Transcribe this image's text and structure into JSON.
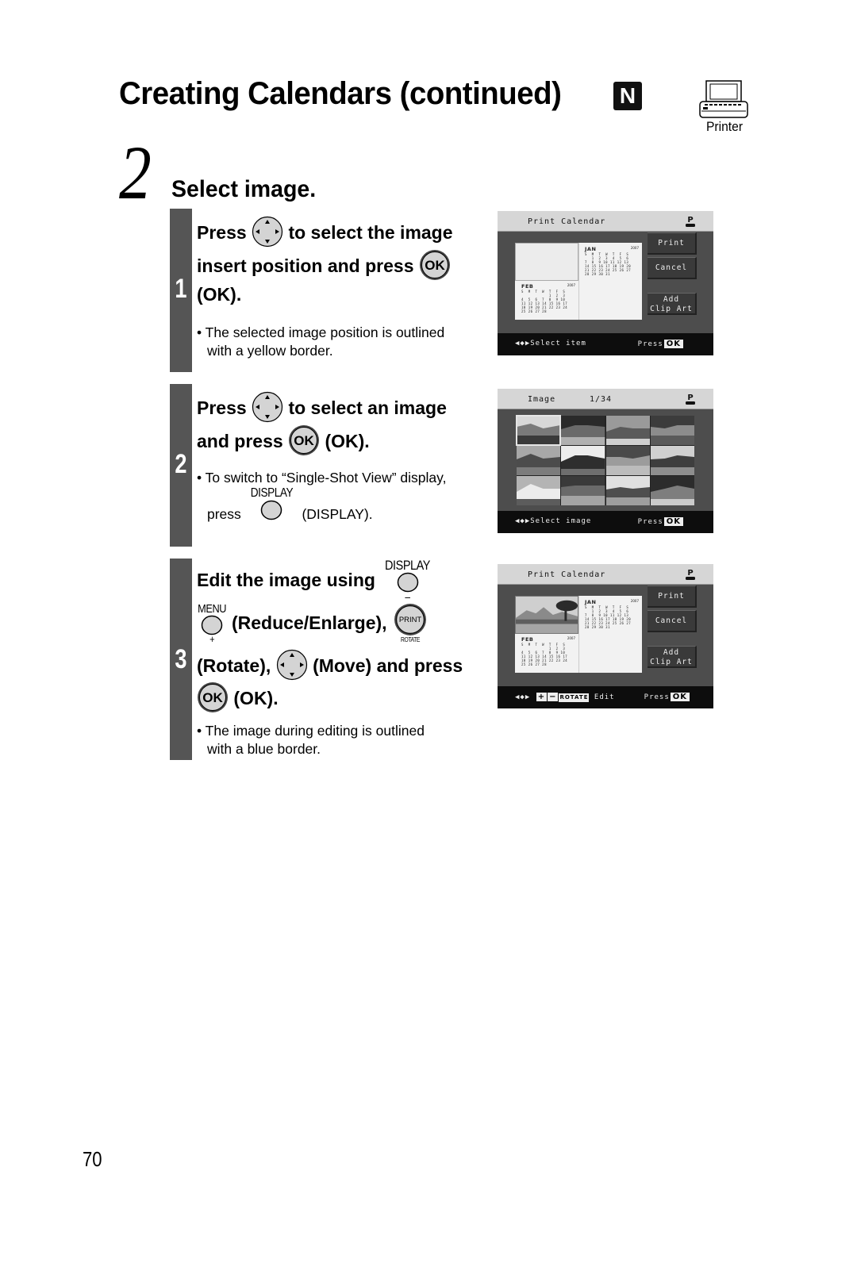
{
  "header": {
    "title": "Creating Calendars (continued)",
    "mode_badge": "N",
    "device_label": "Printer"
  },
  "step": {
    "number": "2",
    "title": "Select image."
  },
  "substeps": [
    {
      "number": "1",
      "line1_a": "Press",
      "line1_b": "to select the image",
      "line2_a": "insert position and press",
      "line3_a": "(OK).",
      "ok_glyph": "OK",
      "note_line1": "• The selected image position is outlined",
      "note_line2": "with a yellow border.",
      "screen": {
        "title": "Print Calendar",
        "buttons": [
          "Print",
          "Cancel",
          "Add",
          "Clip Art"
        ],
        "footer_left": "◀◆▶Select item",
        "footer_press": "Press",
        "footer_ok": "OK",
        "calendar": {
          "jan": {
            "name": "JAN",
            "year": "2007",
            "grid": "S  M  T  W  T  F  S\n   1  2  3  4  5  6\n7  8  9 10 11 12 13\n14 15 16 17 18 19 20\n21 22 23 24 25 26 27\n28 29 30 31"
          },
          "feb": {
            "name": "FEB",
            "year": "2007",
            "grid": "S  M  T  W  T  F  S\n            1  2  3\n4  5  6  7  8  9 10\n11 12 13 14 15 16 17\n18 19 20 21 22 23 24\n25 26 27 28"
          }
        }
      }
    },
    {
      "number": "2",
      "line1_a": "Press",
      "line1_b": "to select an image",
      "line2_a": "and press",
      "line2_b": "(OK).",
      "ok_glyph": "OK",
      "note_line1": "• To switch to “Single-Shot View” display,",
      "note_line2_a": "press",
      "note_line2_b": "(DISPLAY).",
      "display_label": "DISPLAY",
      "screen": {
        "title": "Image",
        "count": "1/34",
        "footer_left": "◀◆▶Select image",
        "footer_press": "Press",
        "footer_ok": "OK",
        "thumbnail_count": 12
      }
    },
    {
      "number": "3",
      "line1_a": "Edit the image using",
      "display_label": "DISPLAY",
      "minus_label": "–",
      "menu_label": "MENU",
      "plus_label": "+",
      "line2_a": "(Reduce/Enlarge),",
      "print_glyph": "PRINT",
      "rotate_label": "ROTATE",
      "line3_a": "(Rotate),",
      "line3_b": "(Move) and press",
      "line4_a": "(OK).",
      "ok_glyph": "OK",
      "note_line1": "• The image during editing is outlined",
      "note_line2": "with a blue border.",
      "screen": {
        "title": "Print Calendar",
        "buttons": [
          "Print",
          "Cancel",
          "Add",
          "Clip Art"
        ],
        "footer_icons": "◀◆▶",
        "footer_plus": "+",
        "footer_minus": "−",
        "footer_rotate": "ROTATE",
        "footer_edit": "Edit",
        "footer_press": "Press",
        "footer_ok": "OK"
      }
    }
  ],
  "footer": {
    "page_number": "70"
  }
}
